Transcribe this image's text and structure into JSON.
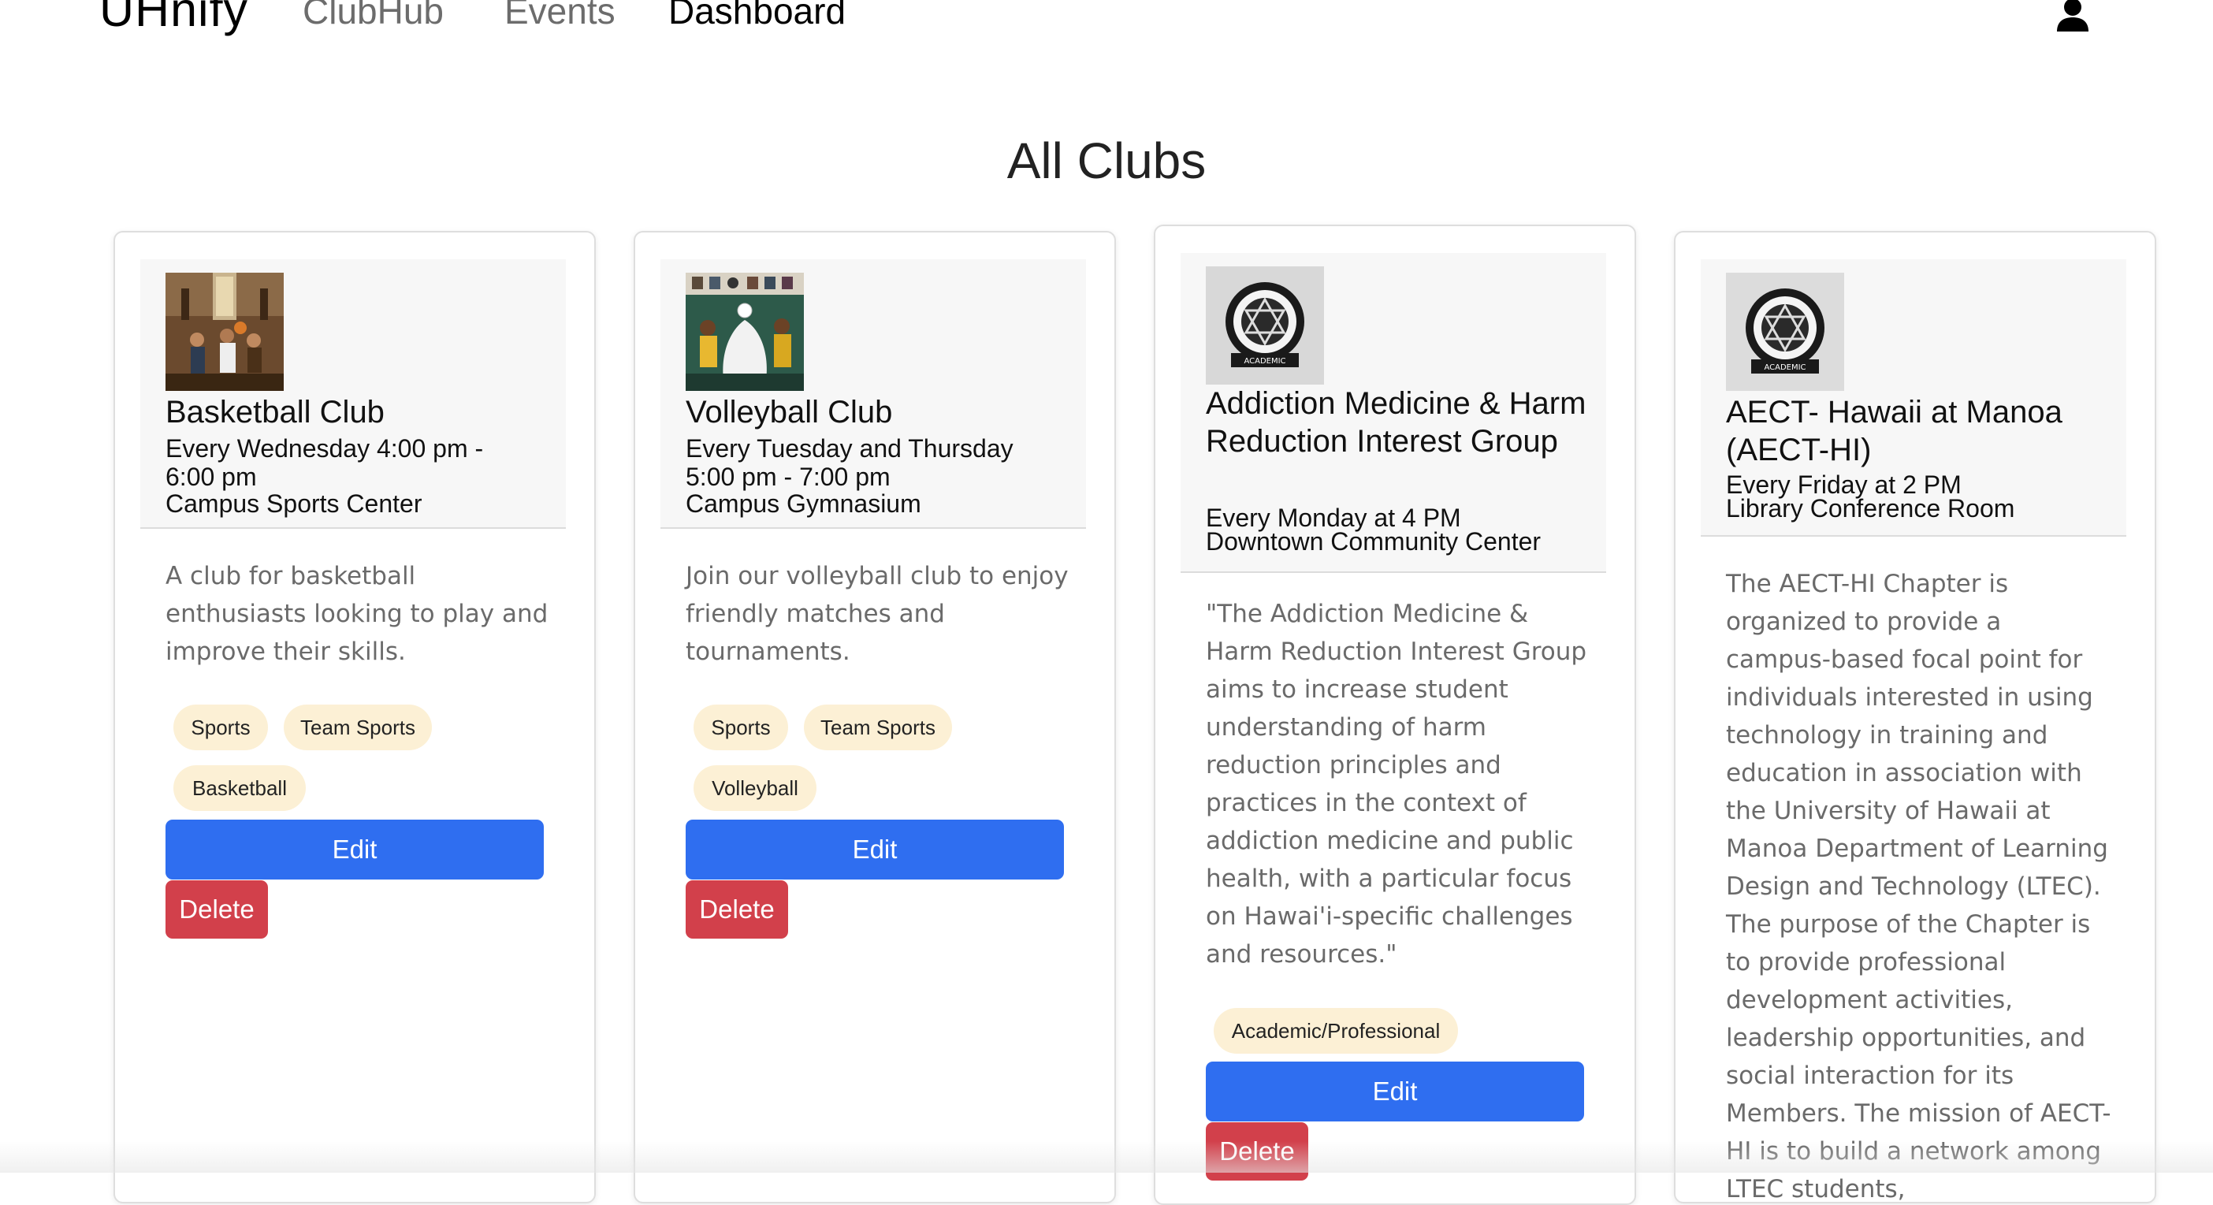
{
  "nav": {
    "brand": "UHnify",
    "links": [
      "ClubHub",
      "Events",
      "Dashboard"
    ],
    "active": "Dashboard",
    "user_icon": "user-icon"
  },
  "page": {
    "title": "All Clubs"
  },
  "clubs": [
    {
      "name": "Basketball Club",
      "schedule": "Every Wednesday 4:00 pm - 6:00 pm",
      "location": "Campus Sports Center",
      "description": "A club for basketball enthusiasts looking to play and improve their skills.",
      "tags": [
        "Sports",
        "Team Sports",
        "Basketball"
      ],
      "edit_label": "Edit",
      "delete_label": "Delete"
    },
    {
      "name": "Volleyball Club",
      "schedule": "Every Tuesday and Thursday 5:00 pm - 7:00 pm",
      "location": "Campus Gymnasium",
      "description": "Join our volleyball club to enjoy friendly matches and tournaments.",
      "tags": [
        "Sports",
        "Team Sports",
        "Volleyball"
      ],
      "edit_label": "Edit",
      "delete_label": "Delete"
    },
    {
      "name": "Addiction Medicine & Harm Reduction Interest Group",
      "schedule": "Every Monday at 4 PM",
      "location": "Downtown Community Center",
      "description": "\"The Addiction Medicine & Harm Reduction Interest Group aims to increase student understanding of harm reduction principles and practices in the context of addiction medicine and public health, with a particular focus on Hawai'i-specific challenges and resources.\"",
      "tags": [
        "Academic/Professional"
      ],
      "logo_text": "ACADEMIC",
      "edit_label": "Edit",
      "delete_label": "Delete"
    },
    {
      "name": "AECT- Hawaii at Manoa (AECT-HI)",
      "schedule": "Every Friday at 2 PM",
      "location": "Library Conference Room",
      "description": "The AECT-HI Chapter is organized to provide a campus-based focal point for individuals interested in using technology in training and education in association with the University of Hawaii at Manoa Department of Learning Design and Technology (LTEC). The purpose of the Chapter is to provide professional development activities, leadership opportunities, and social interaction for its Members. The mission of AECT-HI is to build a network among LTEC students,",
      "logo_text": "ACADEMIC"
    }
  ],
  "colors": {
    "edit_button": "#2f6ef0",
    "delete_button": "#d2404b",
    "tag_bg": "#fcf0d5",
    "card_header_bg": "#f7f7f7"
  }
}
